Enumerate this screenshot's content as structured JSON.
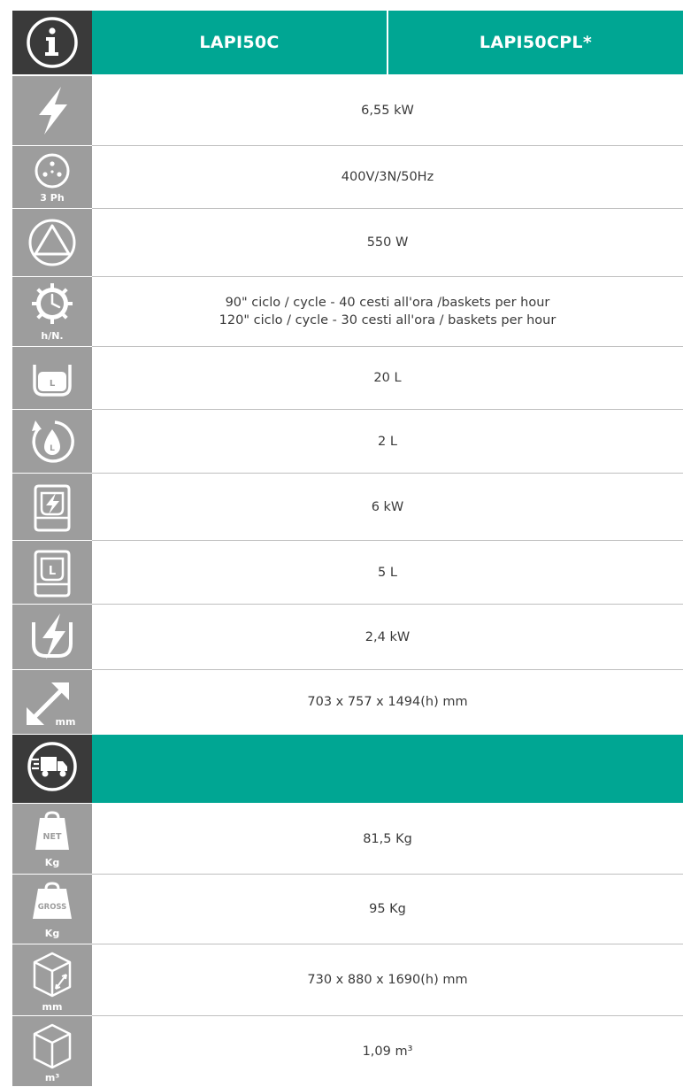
{
  "header": {
    "models": [
      "LAPI50C",
      "LAPI50CPL*"
    ],
    "icon": "info-icon"
  },
  "specs": [
    {
      "icon": "lightning-bolt-icon",
      "icon_label": "",
      "value": [
        "6,55 kW"
      ]
    },
    {
      "icon": "three-phase-plug-icon",
      "icon_label": "3 Ph",
      "value": [
        "400V/3N/50Hz"
      ]
    },
    {
      "icon": "triangle-power-icon",
      "icon_label": "",
      "value": [
        "550 W"
      ]
    },
    {
      "icon": "cycle-clock-icon",
      "icon_label": "h/N.",
      "value": [
        "90\" ciclo / cycle - 40 cesti all'ora /baskets per hour",
        "120\" ciclo / cycle - 30 cesti all'ora / baskets per hour"
      ]
    },
    {
      "icon": "tank-capacity-icon",
      "icon_label": "L",
      "value": [
        "20 L"
      ]
    },
    {
      "icon": "rinse-water-drop-icon",
      "icon_label": "L",
      "value": [
        "2 L"
      ]
    },
    {
      "icon": "boiler-power-icon",
      "icon_label": "",
      "value": [
        "6 kW"
      ]
    },
    {
      "icon": "boiler-capacity-icon",
      "icon_label": "L",
      "value": [
        "5 L"
      ]
    },
    {
      "icon": "tank-heating-icon",
      "icon_label": "",
      "value": [
        "2,4 kW"
      ]
    },
    {
      "icon": "dimensions-arrow-icon",
      "icon_label": "mm",
      "value": [
        "703 x 757 x 1494(h) mm"
      ]
    }
  ],
  "shipping_header": {
    "icon": "delivery-truck-icon"
  },
  "shipping": [
    {
      "icon": "net-weight-icon",
      "icon_label": "Kg",
      "badge": "NET",
      "value": [
        "81,5 Kg"
      ]
    },
    {
      "icon": "gross-weight-icon",
      "icon_label": "Kg",
      "badge": "GROSS",
      "value": [
        "95 Kg"
      ]
    },
    {
      "icon": "package-dimensions-icon",
      "icon_label": "mm",
      "value": [
        "730 x 880 x 1690(h) mm"
      ]
    },
    {
      "icon": "package-volume-icon",
      "icon_label": "m³",
      "value": [
        "1,09 m³"
      ]
    }
  ],
  "colors": {
    "teal": "#00a693",
    "icon_gray": "#9d9d9d",
    "dark": "#3a3a3a",
    "text": "#3a3a3a"
  }
}
